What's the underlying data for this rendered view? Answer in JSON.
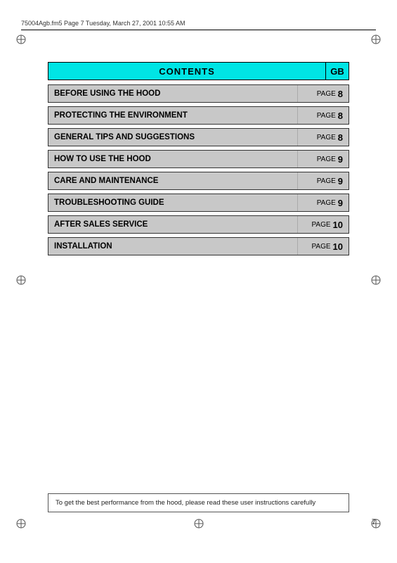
{
  "header": {
    "text": "75004Agb.fm5  Page 7  Tuesday, March 27, 2001  10:55 AM"
  },
  "contents": {
    "title": "CONTENTS",
    "gb_label": "GB"
  },
  "toc": {
    "rows": [
      {
        "title": "BEFORE USING THE HOOD",
        "page_label": "PAGE",
        "page_num": "8"
      },
      {
        "title": "PROTECTING THE ENVIRONMENT",
        "page_label": "PAGE",
        "page_num": "8"
      },
      {
        "title": "GENERAL TIPS AND SUGGESTIONS",
        "page_label": "PAGE",
        "page_num": "8"
      },
      {
        "title": "HOW TO USE THE HOOD",
        "page_label": "PAGE",
        "page_num": "9"
      },
      {
        "title": "CARE AND MAINTENANCE",
        "page_label": "PAGE",
        "page_num": "9"
      },
      {
        "title": "TROUBLESHOOTING GUIDE",
        "page_label": "PAGE",
        "page_num": "9"
      },
      {
        "title": "AFTER SALES SERVICE",
        "page_label": "PAGE",
        "page_num": "10"
      },
      {
        "title": "INSTALLATION",
        "page_label": "PAGE",
        "page_num": "10"
      }
    ]
  },
  "footer": {
    "note": "To get the best performance from the hood, please read these user instructions carefully"
  },
  "page_number": "7"
}
